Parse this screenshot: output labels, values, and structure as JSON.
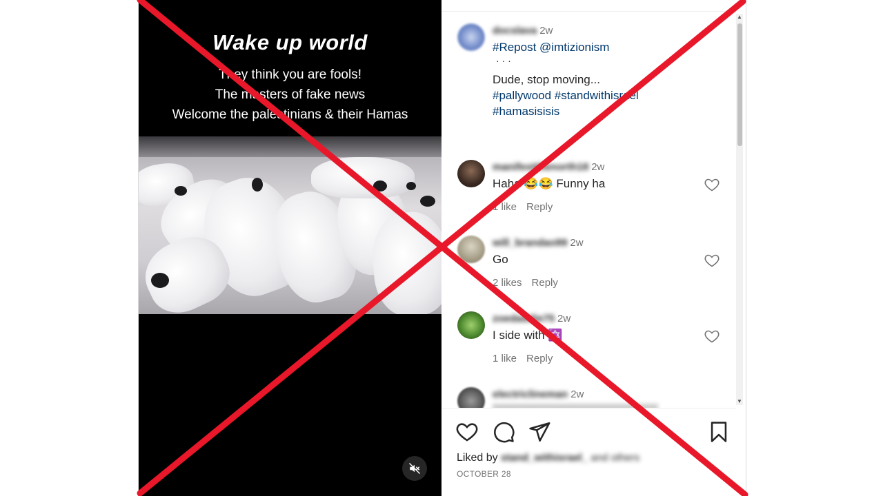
{
  "video": {
    "title": "Wake up world",
    "lines": [
      "They think you are fools!",
      "The masters of fake news",
      "Welcome the palestinians & their Hamas"
    ],
    "mute_icon": "speaker-muted-icon"
  },
  "post": {
    "author": "docslava",
    "time": "2w",
    "caption_line1": "#Repost @imtizionism",
    "dots": "·   ·   ·",
    "caption_line2": "Dude, stop moving...",
    "caption_line3": "#pallywood #standwithisrael",
    "caption_line4": "#hamasisisis"
  },
  "comments": [
    {
      "user": "manifestthenorth18",
      "time": "2w",
      "text": "Haha 😂😂 Funny ha",
      "likes": "1 like",
      "reply": "Reply"
    },
    {
      "user": "will_brandao99",
      "time": "2w",
      "text": "Go",
      "likes": "2 likes",
      "reply": "Reply"
    },
    {
      "user": "zoedaddie75",
      "time": "2w",
      "text": "I side with ✡️",
      "likes": "1 like",
      "reply": "Reply"
    },
    {
      "user": "electriclineman",
      "time": "2w",
      "text": "",
      "likes": "",
      "reply": ""
    }
  ],
  "footer": {
    "liked_by_prefix": "Liked by",
    "liked_by_user": "stand_withisrael_",
    "liked_by_suffix": "and others",
    "date": "OCTOBER 28"
  },
  "colors": {
    "cross": "#e8182a",
    "hashtag": "#00376b",
    "muted_text": "#737373"
  }
}
